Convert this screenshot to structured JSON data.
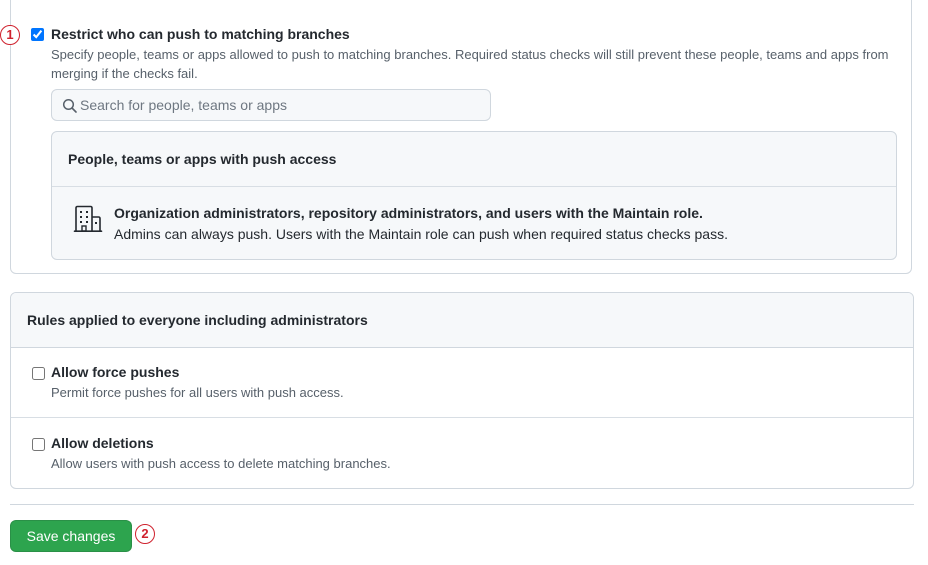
{
  "restrict": {
    "callout": "1",
    "checked": true,
    "label": "Restrict who can push to matching branches",
    "description": "Specify people, teams or apps allowed to push to matching branches. Required status checks will still prevent these people, teams and apps from merging if the checks fail.",
    "search_placeholder": "Search for people, teams or apps",
    "access_panel": {
      "title": "People, teams or apps with push access",
      "icon": "organization-icon",
      "entry_title": "Organization administrators, repository administrators, and users with the Maintain role.",
      "entry_desc": "Admins can always push. Users with the Maintain role can push when required status checks pass."
    }
  },
  "rules": {
    "title": "Rules applied to everyone including administrators",
    "items": [
      {
        "label": "Allow force pushes",
        "description": "Permit force pushes for all users with push access.",
        "checked": false
      },
      {
        "label": "Allow deletions",
        "description": "Allow users with push access to delete matching branches.",
        "checked": false
      }
    ]
  },
  "footer": {
    "save_label": "Save changes",
    "callout": "2"
  },
  "colors": {
    "accent_green": "#2da44e",
    "callout_red": "#cf222e",
    "border": "#d0d7de"
  }
}
